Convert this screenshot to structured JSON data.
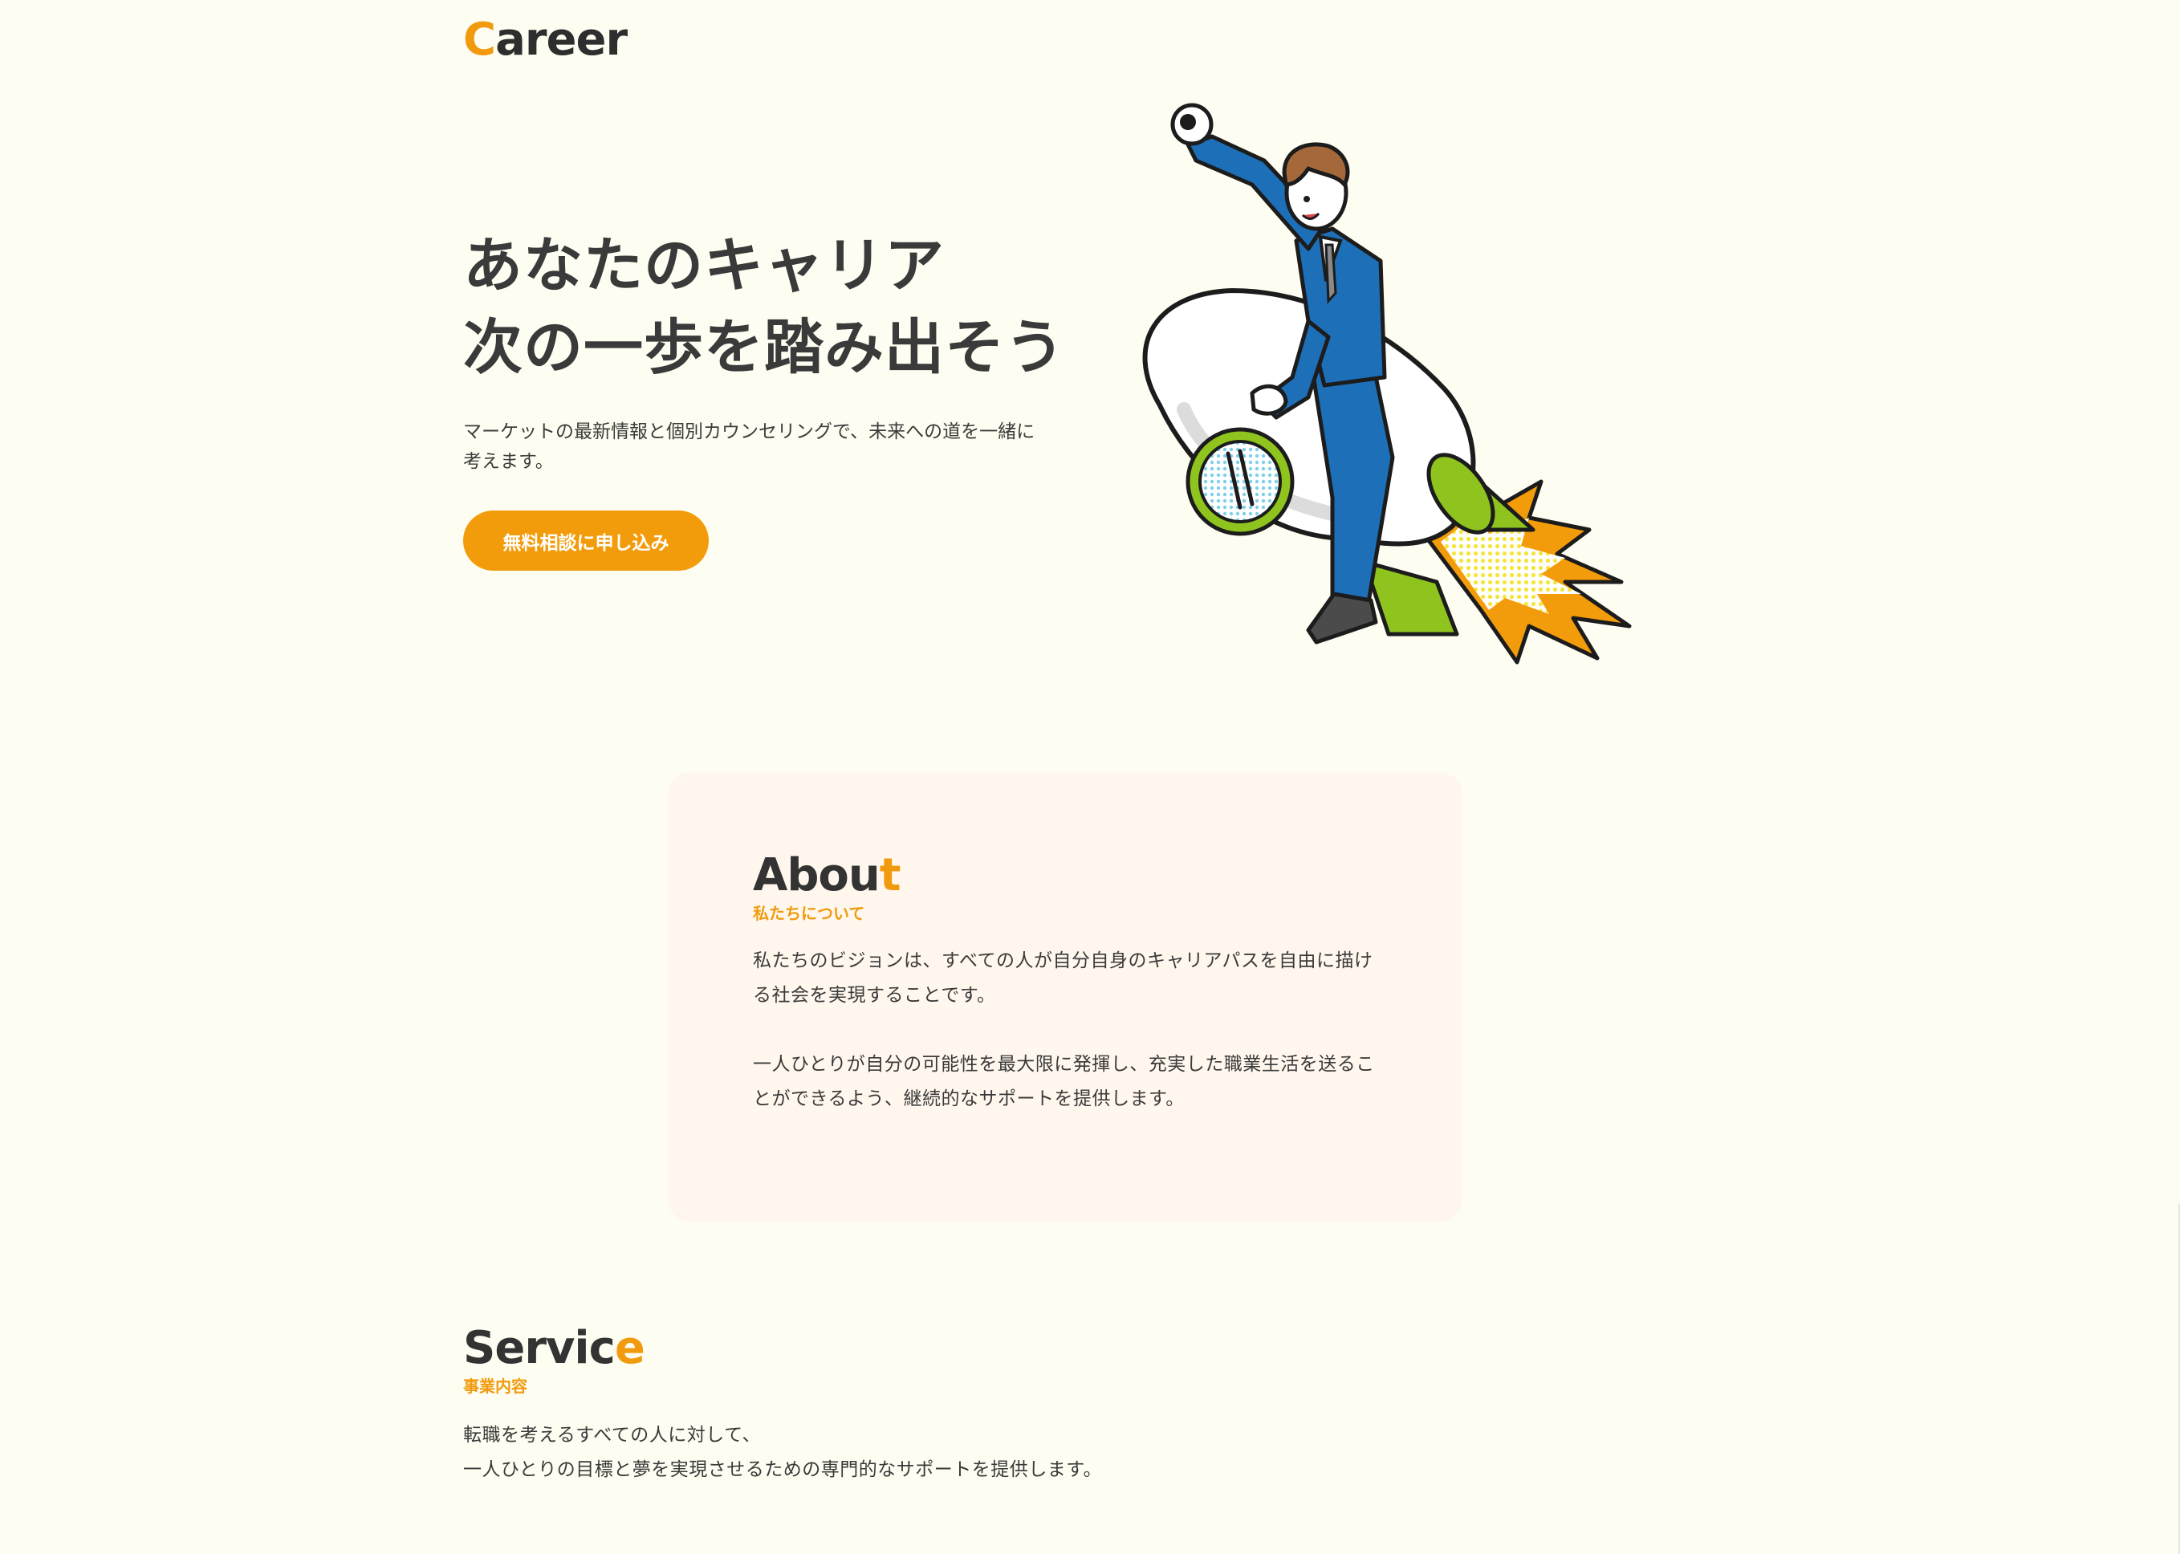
{
  "header": {
    "logo_initial": "C",
    "logo_rest": "areer"
  },
  "hero": {
    "title_line1": "あなたのキャリア",
    "title_line2": "次の一歩を踏み出そう",
    "description": "マーケットの最新情報と個別カウンセリングで、未来への道を一緒に考えます。",
    "cta_label": "無料相談に申し込み"
  },
  "about": {
    "title_main": "Abou",
    "title_accent": "t",
    "subtitle": "私たちについて",
    "paragraph1": "私たちのビジョンは、すべての人が自分自身のキャリアパスを自由に描ける社会を実現することです。",
    "paragraph2": "一人ひとりが自分の可能性を最大限に発揮し、充実した職業生活を送ることができるよう、継続的なサポートを提供します。"
  },
  "service": {
    "title_main": "Servic",
    "title_accent": "e",
    "subtitle": "事業内容",
    "line1": "転職を考えるすべての人に対して、",
    "line2": "一人ひとりの目標と夢を実現させるための専門的なサポートを提供します。"
  },
  "colors": {
    "background": "#fefdf1",
    "accent": "#f19a0e",
    "button": "#f39c0b",
    "card": "#fff7ed",
    "text": "#333333"
  },
  "icons": {
    "hero_illustration": "businessman-riding-rocket-illustration"
  }
}
